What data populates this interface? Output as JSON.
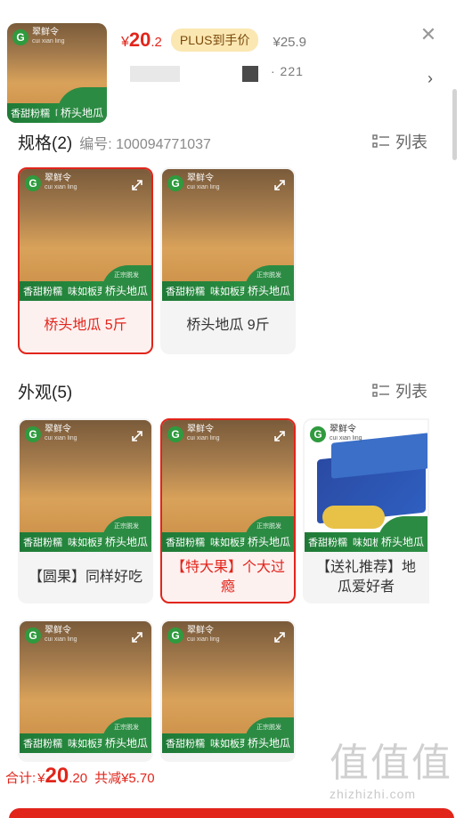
{
  "header": {
    "price_currency": "¥",
    "price_int": "20",
    "price_dec": ".2",
    "plus_badge": "PLUS到手价",
    "original_price": "¥25.9",
    "masked_tail": "· 221",
    "close_icon": "close-icon",
    "chevron_icon": "chevron-right-icon"
  },
  "spec_section": {
    "title": "规格(2)",
    "sku_label": "编号: 100094771037",
    "list_toggle": "列表",
    "items": [
      {
        "label": "桥头地瓜 5斤",
        "selected": true
      },
      {
        "label": "桥头地瓜 9斤",
        "selected": false
      }
    ]
  },
  "appearance_section": {
    "title": "外观(5)",
    "list_toggle": "列表",
    "items": [
      {
        "label": "【圆果】同样好吃",
        "selected": false
      },
      {
        "label": "【特大果】个大过瘾",
        "selected": true
      },
      {
        "label": "【送礼推荐】地瓜爱好者",
        "selected": false
      },
      {
        "label": "",
        "selected": false
      },
      {
        "label": "",
        "selected": false
      }
    ]
  },
  "product_image": {
    "brand": "翠鲜令",
    "brand_pinyin": "cui xian ling",
    "tag1": "香甜粉糯",
    "tag2": "味如板栗",
    "tag3": "桥头地瓜",
    "tag3_sub": "正宗脱发"
  },
  "footer": {
    "total_label": "合计:",
    "currency": "¥",
    "total_int": "20",
    "total_dec": ".20",
    "discount": "共减¥5.70",
    "watermark": "值值值",
    "watermark_url": "zhizhizhi.com"
  },
  "colors": {
    "accent": "#e1251b",
    "plus_badge_bg": "#fbe7b2",
    "brand_green": "#2c8b43"
  }
}
